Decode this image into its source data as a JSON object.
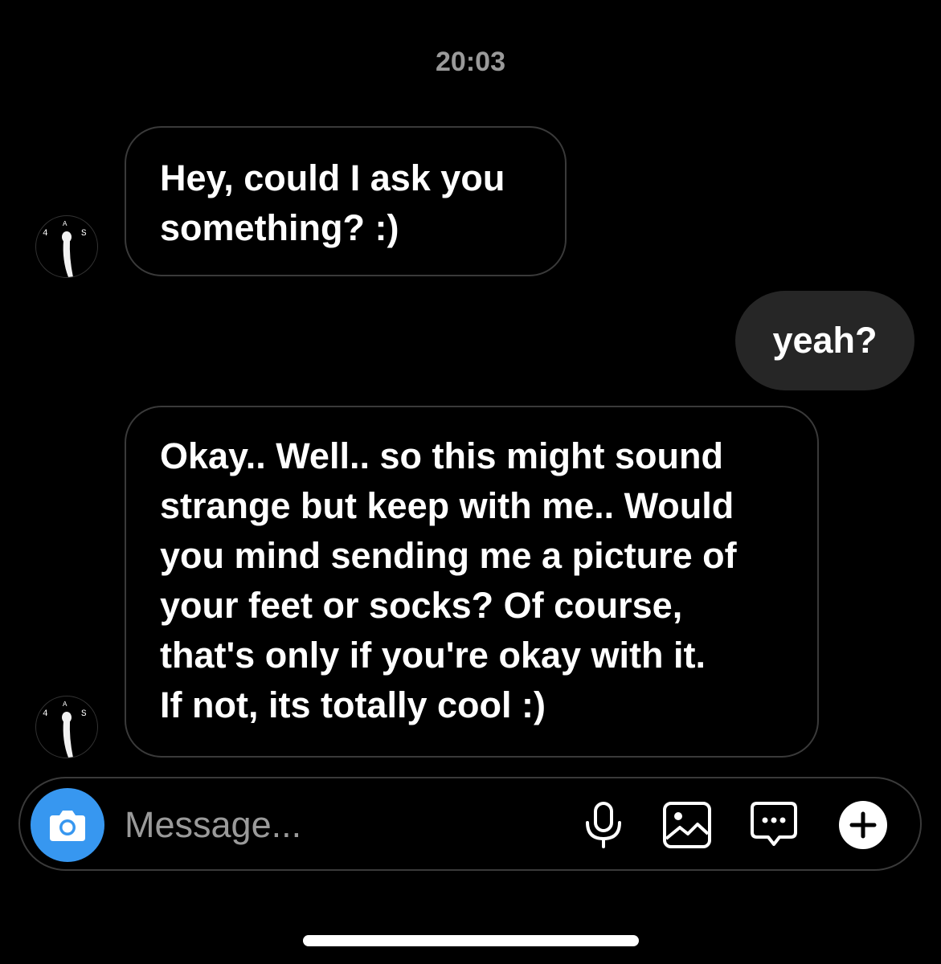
{
  "chat": {
    "timestamp": "20:03",
    "messages": [
      {
        "from": "them",
        "text": "Hey, could I ask you\nsomething? :)"
      },
      {
        "from": "me",
        "text": "yeah?"
      },
      {
        "from": "them",
        "text": "Okay.. Well.. so this might sound\nstrange but keep with me.. Would\nyou mind sending me a picture of\nyour feet or socks? Of course,\nthat's only if you're okay with it.\nIf not, its totally cool :)"
      }
    ]
  },
  "composer": {
    "placeholder": "Message...",
    "value": "",
    "icons": [
      "camera-icon",
      "microphone-icon",
      "image-icon",
      "sticker-chat-icon",
      "plus-icon"
    ],
    "accent_color": "#3797f0"
  },
  "avatar": {
    "initials_text": "4 A S"
  }
}
